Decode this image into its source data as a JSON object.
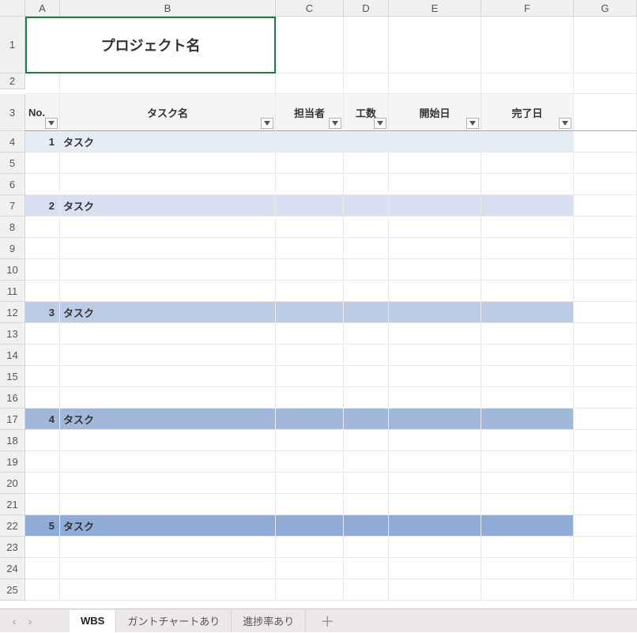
{
  "columns": [
    "A",
    "B",
    "C",
    "D",
    "E",
    "F",
    "G"
  ],
  "row_numbers": [
    "1",
    "2",
    "3",
    "4",
    "5",
    "6",
    "7",
    "8",
    "9",
    "10",
    "11",
    "12",
    "13",
    "14",
    "15",
    "16",
    "17",
    "18",
    "19",
    "20",
    "21",
    "22",
    "23",
    "24",
    "25"
  ],
  "title": "プロジェクト名",
  "headers": {
    "no": "No.",
    "task_name": "タスク名",
    "assignee": "担当者",
    "effort": "工数",
    "start_date": "開始日",
    "end_date": "完了日"
  },
  "tasks": [
    {
      "no": "1",
      "name": "タスク",
      "row": 4
    },
    {
      "no": "2",
      "name": "タスク",
      "row": 7
    },
    {
      "no": "3",
      "name": "タスク",
      "row": 12
    },
    {
      "no": "4",
      "name": "タスク",
      "row": 17
    },
    {
      "no": "5",
      "name": "タスク",
      "row": 22
    }
  ],
  "tabs": {
    "prev": "‹",
    "next": "›",
    "items": [
      "WBS",
      "ガントチャートあり",
      "進捗率あり"
    ],
    "active_index": 0,
    "add": "＋"
  }
}
